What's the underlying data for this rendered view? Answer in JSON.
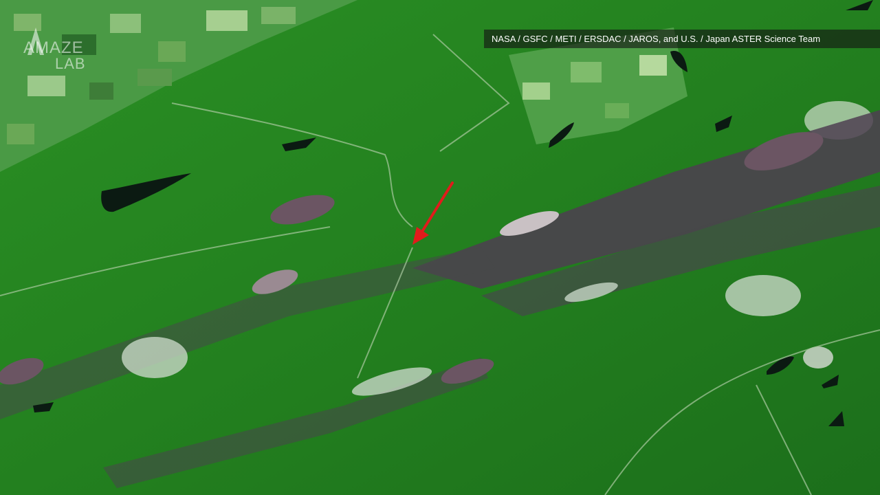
{
  "credit": "NASA / GSFC / METI / ERSDAC / JAROS, and U.S. / Japan ASTER Science Team",
  "logo": {
    "line1": "AMAZE",
    "line2": "LAB"
  },
  "colors": {
    "forest": "#1f7a1c",
    "arrow": "#e11b1b",
    "water": "#0b1a12",
    "mine": "#5a4a58"
  }
}
